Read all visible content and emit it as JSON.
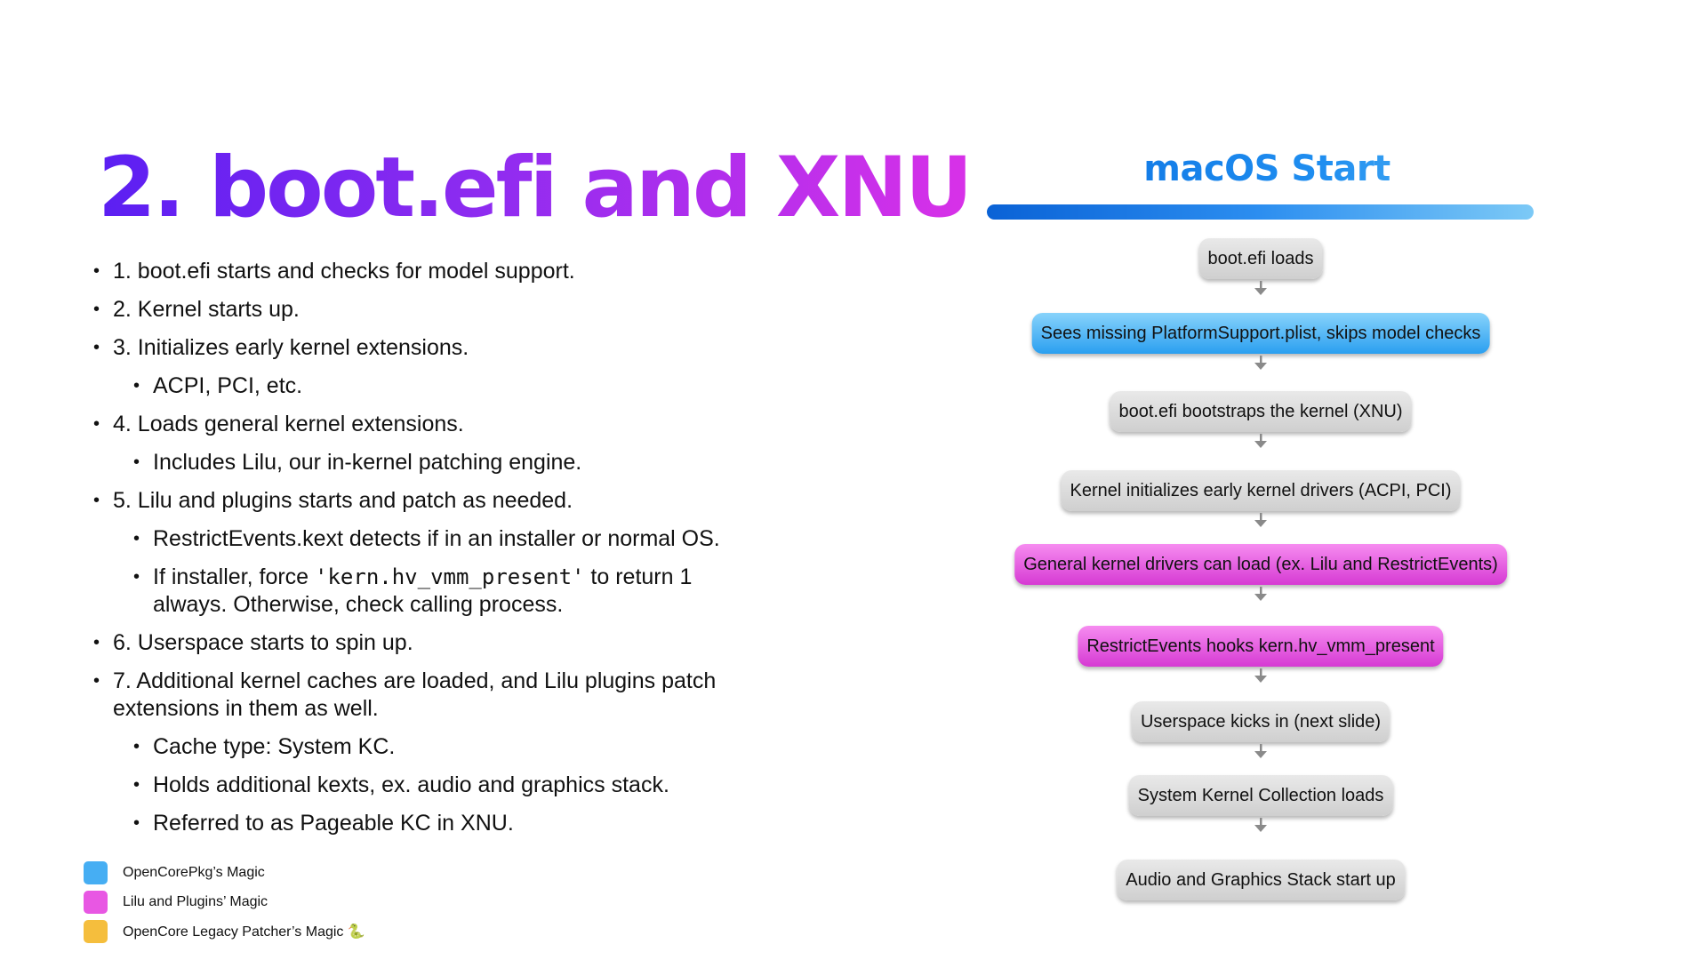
{
  "slide": {
    "title": "2. boot.efi and XNU"
  },
  "bullets": [
    {
      "level": 1,
      "text": "1. boot.efi starts and checks for model support."
    },
    {
      "level": 1,
      "text": "2. Kernel starts up."
    },
    {
      "level": 1,
      "text": "3. Initializes early kernel extensions."
    },
    {
      "level": 2,
      "text": "ACPI, PCI, etc."
    },
    {
      "level": 1,
      "text": "4. Loads general kernel extensions."
    },
    {
      "level": 2,
      "text": "Includes Lilu, our in-kernel patching engine."
    },
    {
      "level": 1,
      "text": "5. Lilu and plugins starts and patch as needed."
    },
    {
      "level": 2,
      "text": "RestrictEvents.kext detects if in an installer or normal OS."
    },
    {
      "level": 2,
      "pre": "If installer, force ",
      "code": "'kern.hv_vmm_present'",
      "post": " to return 1 always. Otherwise, check calling process."
    },
    {
      "level": 1,
      "text": "6. Userspace starts to spin up."
    },
    {
      "level": 1,
      "text": "7. Additional kernel caches are loaded, and Lilu plugins patch extensions in them as well."
    },
    {
      "level": 2,
      "text": "Cache type: System KC."
    },
    {
      "level": 2,
      "text": "Holds additional kexts, ex. audio and graphics stack."
    },
    {
      "level": 2,
      "text": "Referred to as Pageable KC in XNU."
    }
  ],
  "legend": [
    {
      "label": "OpenCorePkg’s Magic",
      "color": "#46aef3",
      "icon": "swatch-blue"
    },
    {
      "label": "Lilu and Plugins’ Magic",
      "color": "#e857e3",
      "icon": "swatch-pink"
    },
    {
      "label": "OpenCore Legacy Patcher’s Magic 🐍",
      "color": "#f5be3d",
      "icon": "swatch-yellow"
    }
  ],
  "flow": {
    "title": "macOS Start",
    "steps": [
      {
        "label": "boot.efi loads",
        "style": "gray"
      },
      {
        "label": "Sees missing PlatformSupport.plist, skips model checks",
        "style": "blue"
      },
      {
        "label": "boot.efi bootstraps the kernel (XNU)",
        "style": "gray"
      },
      {
        "label": "Kernel initializes early kernel drivers (ACPI, PCI)",
        "style": "gray"
      },
      {
        "label": "General kernel drivers can load (ex. Lilu and RestrictEvents)",
        "style": "pink"
      },
      {
        "label": "RestrictEvents hooks kern.hv_vmm_present",
        "style": "pink"
      },
      {
        "label": "Userspace kicks in (next slide)",
        "style": "gray"
      },
      {
        "label": "System Kernel Collection loads",
        "style": "gray"
      },
      {
        "label": "Audio and Graphics Stack start up",
        "style": "gray"
      }
    ]
  }
}
